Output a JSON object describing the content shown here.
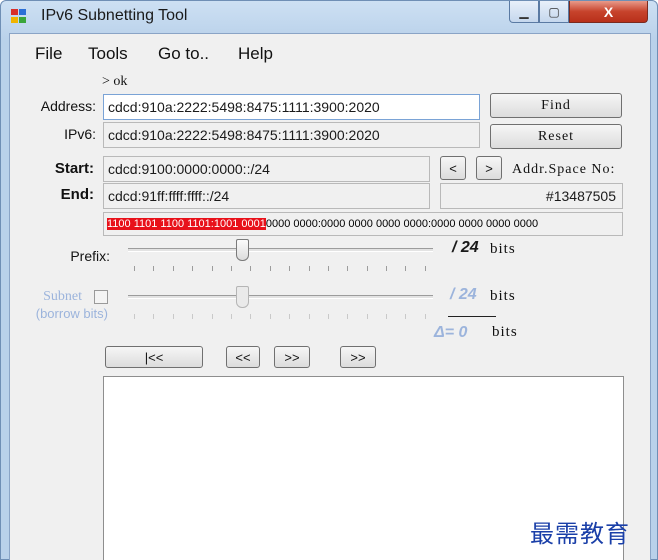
{
  "window": {
    "title": "IPv6 Subnetting Tool",
    "close_glyph": "X",
    "min_glyph": "▁",
    "max_glyph": "▢"
  },
  "menu": [
    "File",
    "Tools",
    "Go to..",
    "Help"
  ],
  "status": "> ok",
  "address": {
    "label": "Address:",
    "value": "cdcd:910a:2222:5498:8475:1111:3900:2020"
  },
  "ipv6": {
    "label": "IPv6:",
    "value": "cdcd:910a:2222:5498:8475:1111:3900:2020"
  },
  "buttons": {
    "find": "Find",
    "reset": "Reset",
    "prev": "<",
    "next": ">"
  },
  "start": {
    "label": "Start:",
    "value": "cdcd:9100:0000:0000::/24"
  },
  "end": {
    "label": "End:",
    "value": "cdcd:91ff:ffff:ffff::/24"
  },
  "addr_space": {
    "label": "Addr.Space No:",
    "value": "#13487505"
  },
  "bits": {
    "highlight": "1100 1101 1100 1101:1001 0001",
    "rest": "0000 0000:0000 0000 0000 0000:0000 0000 0000 0000"
  },
  "prefix": {
    "label": "Prefix:",
    "value": "/ 24",
    "unit": "bits",
    "level": 24,
    "max": 64
  },
  "subnet": {
    "label": "Subnet",
    "sub_label": "(borrow bits)",
    "value": "/ 24",
    "unit": "bits",
    "checked": false,
    "level": 24,
    "max": 64
  },
  "delta": {
    "value": "Δ= 0",
    "unit": "bits"
  },
  "nav": {
    "first": "|<<",
    "prev": "<<",
    "next": ">>",
    "last": ">>"
  },
  "watermark": "最需教育",
  "colors": {
    "highlight": "#e8111a",
    "disabled_text": "#9cb4dc"
  }
}
